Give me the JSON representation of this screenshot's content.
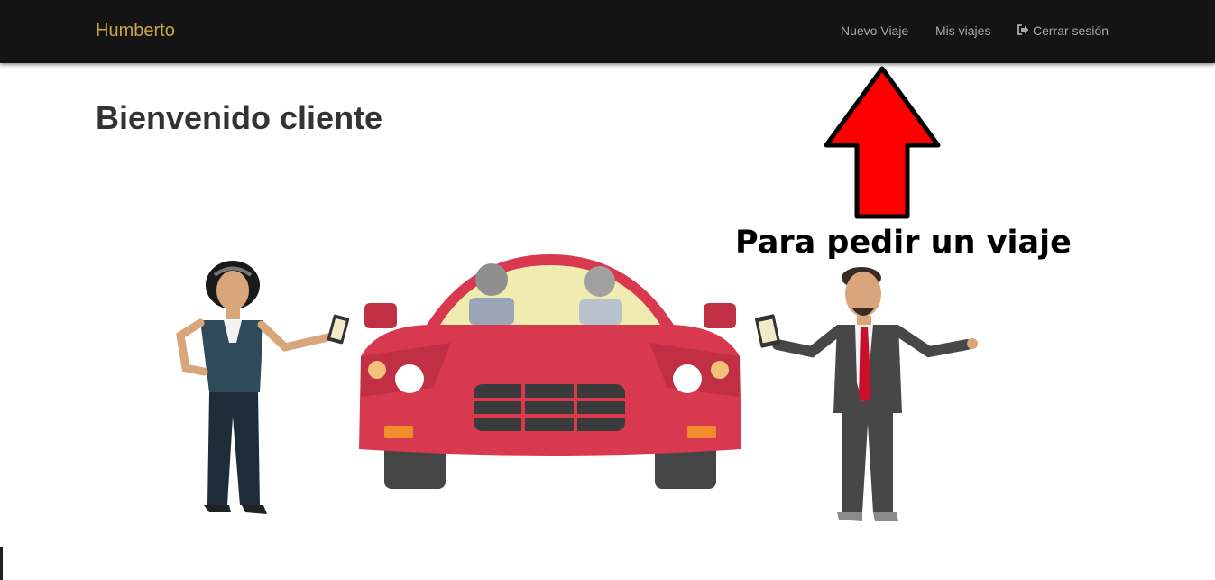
{
  "navbar": {
    "brand": "Humberto",
    "items": [
      {
        "label": "Nuevo Viaje"
      },
      {
        "label": "Mis viajes"
      },
      {
        "label": "Cerrar sesión",
        "icon": "sign-out-icon"
      }
    ]
  },
  "main": {
    "title": "Bienvenido cliente",
    "annotation": "Para pedir un viaje",
    "illustration_icon": "rideshare-illustration",
    "arrow_icon": "red-up-arrow-icon"
  },
  "colors": {
    "navbar_bg": "#141414",
    "brand": "#c9a54a",
    "nav_text": "#a8a8a8",
    "title": "#333333",
    "car": "#d8394e",
    "arrow": "#ff0000"
  }
}
